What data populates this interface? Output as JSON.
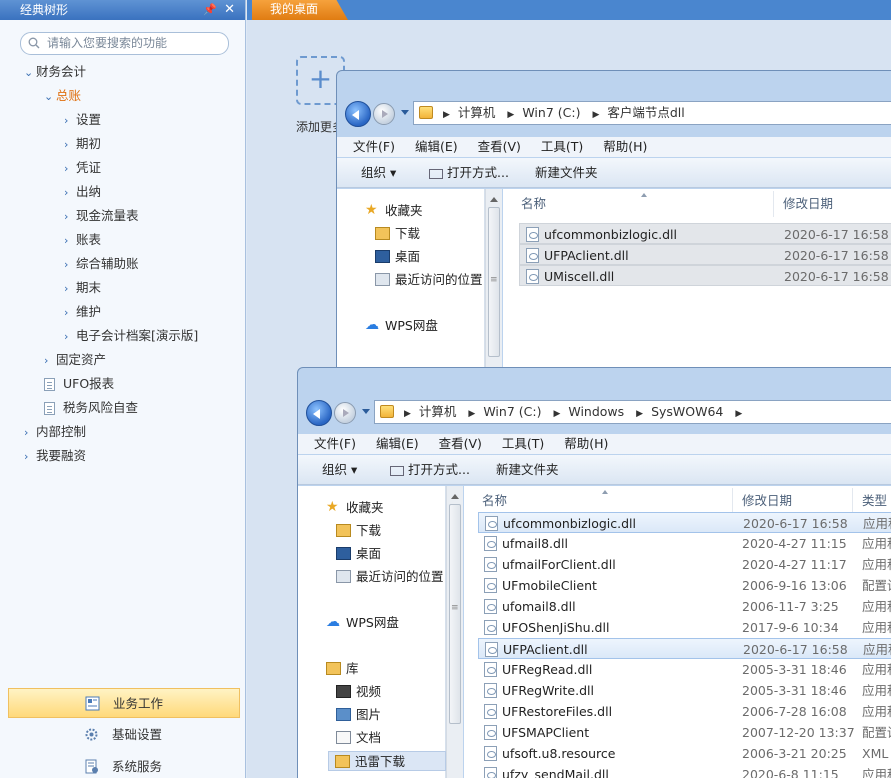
{
  "left_panel": {
    "title": "经典树形",
    "search_placeholder": "请输入您要搜索的功能",
    "tree": [
      {
        "label": "财务会计",
        "expanded": true
      },
      {
        "label": "总账",
        "expanded": true
      },
      {
        "label": "设置"
      },
      {
        "label": "期初"
      },
      {
        "label": "凭证"
      },
      {
        "label": "出纳"
      },
      {
        "label": "现金流量表"
      },
      {
        "label": "账表"
      },
      {
        "label": "综合辅助账"
      },
      {
        "label": "期末"
      },
      {
        "label": "维护"
      },
      {
        "label": "电子会计档案[演示版]"
      },
      {
        "label": "固定资产"
      },
      {
        "label": "UFO报表"
      },
      {
        "label": "税务风险自查"
      },
      {
        "label": "内部控制"
      },
      {
        "label": "我要融资"
      }
    ],
    "bottom_nav": [
      {
        "label": "业务工作",
        "active": true
      },
      {
        "label": "基础设置"
      },
      {
        "label": "系统服务"
      }
    ]
  },
  "tab": {
    "label": "我的桌面"
  },
  "desktop": {
    "add_label": "添加更多"
  },
  "window1": {
    "breadcrumb": [
      "计算机",
      "Win7 (C:)",
      "客户端节点dll"
    ],
    "menu": [
      "文件(F)",
      "编辑(E)",
      "查看(V)",
      "工具(T)",
      "帮助(H)"
    ],
    "toolbar": {
      "organize": "组织",
      "open_with": "打开方式...",
      "new_folder": "新建文件夹"
    },
    "nav": [
      "收藏夹",
      "下载",
      "桌面",
      "最近访问的位置",
      "WPS网盘"
    ],
    "columns": {
      "name": "名称",
      "date": "修改日期"
    },
    "files": [
      {
        "name": "ufcommonbizlogic.dll",
        "date": "2020-6-17 16:58"
      },
      {
        "name": "UFPAclient.dll",
        "date": "2020-6-17 16:58"
      },
      {
        "name": "UMiscell.dll",
        "date": "2020-6-17 16:58"
      }
    ]
  },
  "window2": {
    "breadcrumb": [
      "计算机",
      "Win7 (C:)",
      "Windows",
      "SysWOW64"
    ],
    "menu": [
      "文件(F)",
      "编辑(E)",
      "查看(V)",
      "工具(T)",
      "帮助(H)"
    ],
    "toolbar": {
      "organize": "组织",
      "open_with": "打开方式...",
      "new_folder": "新建文件夹"
    },
    "nav": [
      "收藏夹",
      "下载",
      "桌面",
      "最近访问的位置",
      "WPS网盘",
      "库",
      "视频",
      "图片",
      "文档",
      "迅雷下载"
    ],
    "columns": {
      "name": "名称",
      "date": "修改日期",
      "type": "类型"
    },
    "files": [
      {
        "name": "ufcommonbizlogic.dll",
        "date": "2020-6-17 16:58",
        "type": "应用程"
      },
      {
        "name": "ufmail8.dll",
        "date": "2020-4-27 11:15",
        "type": "应用程"
      },
      {
        "name": "ufmailForClient.dll",
        "date": "2020-4-27 11:17",
        "type": "应用程"
      },
      {
        "name": "UFmobileClient",
        "date": "2006-9-16 13:06",
        "type": "配置设"
      },
      {
        "name": "ufomail8.dll",
        "date": "2006-11-7 3:25",
        "type": "应用程"
      },
      {
        "name": "UFOShenJiShu.dll",
        "date": "2017-9-6 10:34",
        "type": "应用程"
      },
      {
        "name": "UFPAclient.dll",
        "date": "2020-6-17 16:58",
        "type": "应用程"
      },
      {
        "name": "UFRegRead.dll",
        "date": "2005-3-31 18:46",
        "type": "应用程"
      },
      {
        "name": "UFRegWrite.dll",
        "date": "2005-3-31 18:46",
        "type": "应用程"
      },
      {
        "name": "UFRestoreFiles.dll",
        "date": "2006-7-28 16:08",
        "type": "应用程"
      },
      {
        "name": "UFSMAPClient",
        "date": "2007-12-20 13:37",
        "type": "配置设"
      },
      {
        "name": "ufsoft.u8.resource",
        "date": "2006-3-21 20:25",
        "type": "XML"
      },
      {
        "name": "ufzy_sendMail.dll",
        "date": "2020-6-8 11:15",
        "type": "应用程"
      }
    ]
  }
}
